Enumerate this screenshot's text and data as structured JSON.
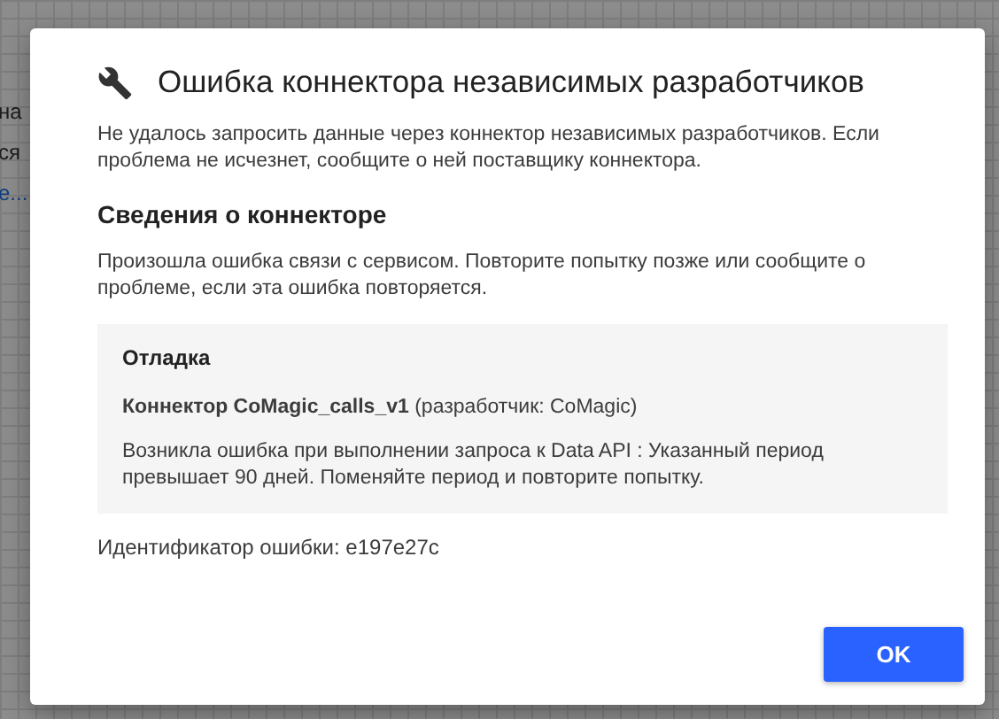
{
  "background": {
    "texts": [
      {
        "text": "на",
        "kind": "plain"
      },
      {
        "text": "ся",
        "kind": "plain"
      },
      {
        "text": "е...",
        "kind": "link"
      }
    ]
  },
  "dialog": {
    "title": "Ошибка коннектора независимых разработчиков",
    "message": "Не удалось запросить данные через коннектор независимых разработчиков. Если проблема не исчезнет, сообщите о ней поставщику коннектора.",
    "section_title": "Сведения о коннекторе",
    "section_text": "Произошла ошибка связи с сервисом. Повторите попытку позже или сообщите о проблеме, если эта ошибка повторяется.",
    "debug": {
      "title": "Отладка",
      "connector": "**Коннектор CoMagic_calls_v1** (разработчик: CoMagic)",
      "details": "Возникла ошибка при выполнении запроса к Data API : Указанный период превышает 90 дней. Поменяйте период и повторите попытку."
    },
    "error_id": "Идентификатор ошибки: e197e27c",
    "buttons": [
      "OK"
    ]
  }
}
